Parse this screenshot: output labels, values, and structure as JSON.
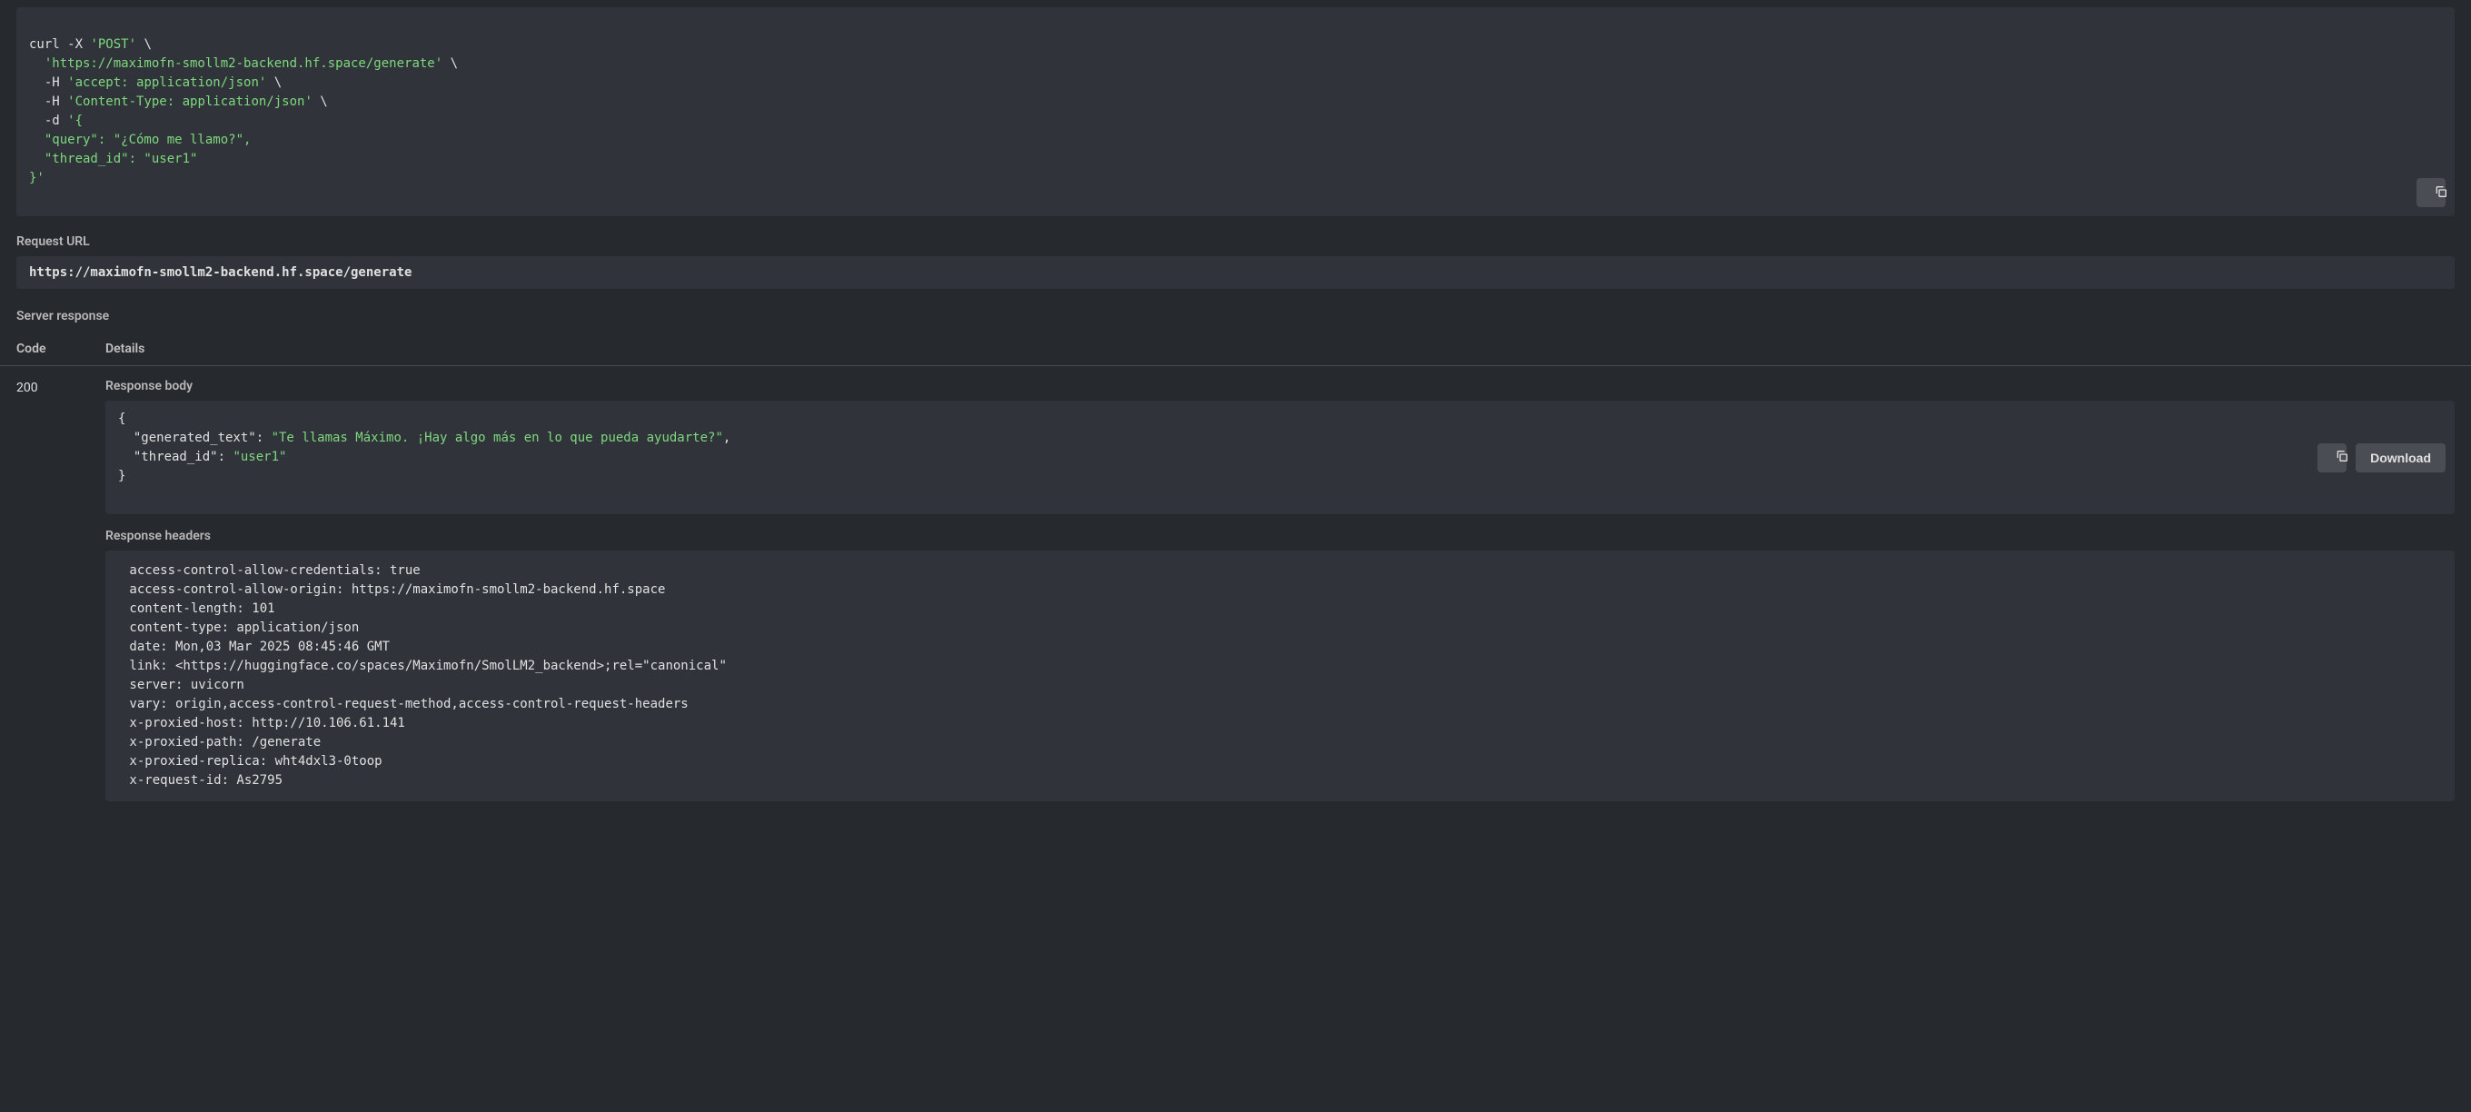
{
  "curl": {
    "line1_base": "curl -X ",
    "line1_str": "'POST'",
    "line1_end": " \\",
    "line2_str": "'https://maximofn-smollm2-backend.hf.space/generate'",
    "line2_end": " \\",
    "line3_base": "  -H ",
    "line3_str": "'accept: application/json'",
    "line3_end": " \\",
    "line4_base": "  -H ",
    "line4_str": "'Content-Type: application/json'",
    "line4_end": " \\",
    "line5_base": "  -d ",
    "line5_str": "'{\n  \"query\": \"¿Cómo me llamo?\",\n  \"thread_id\": \"user1\"\n}'"
  },
  "labels": {
    "request_url": "Request URL",
    "server_response": "Server response",
    "code": "Code",
    "details": "Details",
    "response_body": "Response body",
    "response_headers": "Response headers",
    "download": "Download"
  },
  "request_url": "https://maximofn-smollm2-backend.hf.space/generate",
  "status_code": "200",
  "response_body": {
    "open": "{",
    "key1": "\"generated_text\"",
    "colon": ": ",
    "val1": "\"Te llamas Máximo. ¡Hay algo más en lo que pueda ayudarte?\"",
    "comma": ",",
    "key2": "\"thread_id\"",
    "val2": "\"user1\"",
    "close": "}"
  },
  "response_headers_text": " access-control-allow-credentials: true \n access-control-allow-origin: https://maximofn-smollm2-backend.hf.space \n content-length: 101 \n content-type: application/json \n date: Mon,03 Mar 2025 08:45:46 GMT \n link: <https://huggingface.co/spaces/Maximofn/SmolLM2_backend>;rel=\"canonical\" \n server: uvicorn \n vary: origin,access-control-request-method,access-control-request-headers \n x-proxied-host: http://10.106.61.141 \n x-proxied-path: /generate \n x-proxied-replica: wht4dxl3-0toop \n x-request-id: As2795 "
}
